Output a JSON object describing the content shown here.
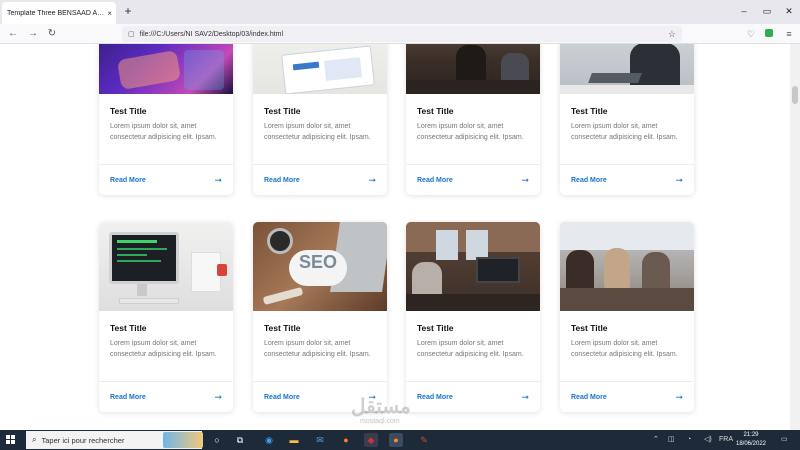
{
  "browser": {
    "tab_title": "Template Three BENSAAD Abdelha",
    "tab_close": "×",
    "new_tab": "+",
    "url": "file:///C:/Users/NI SAV2/Desktop/03/index.html",
    "window_controls": [
      "–",
      "▭",
      "✕"
    ]
  },
  "cards": [
    {
      "title": "Test Title",
      "desc": "Lorem ipsum dolor sit, amet consectetur adipisicing elit. Ipsam.",
      "link": "Read More",
      "arrow": "➞"
    },
    {
      "title": "Test Title",
      "desc": "Lorem ipsum dolor sit, amet consectetur adipisicing elit. Ipsam.",
      "link": "Read More",
      "arrow": "➞"
    },
    {
      "title": "Test Title",
      "desc": "Lorem ipsum dolor sit, amet consectetur adipisicing elit. Ipsam.",
      "link": "Read More",
      "arrow": "➞"
    },
    {
      "title": "Test Title",
      "desc": "Lorem ipsum dolor sit, amet consectetur adipisicing elit. Ipsam.",
      "link": "Read More",
      "arrow": "➞"
    },
    {
      "title": "Test Title",
      "desc": "Lorem ipsum dolor sit, amet consectetur adipisicing elit. Ipsam.",
      "link": "Read More",
      "arrow": "➞"
    },
    {
      "title": "Test Title",
      "desc": "Lorem ipsum dolor sit, amet consectetur adipisicing elit. Ipsam.",
      "link": "Read More",
      "arrow": "➞"
    },
    {
      "title": "Test Title",
      "desc": "Lorem ipsum dolor sit, amet consectetur adipisicing elit. Ipsam.",
      "link": "Read More",
      "arrow": "➞"
    },
    {
      "title": "Test Title",
      "desc": "Lorem ipsum dolor sit, amet consectetur adipisicing elit. Ipsam.",
      "link": "Read More",
      "arrow": "➞"
    }
  ],
  "taskbar": {
    "search_placeholder": "Taper ici pour rechercher",
    "language": "FRA",
    "time": "21:29",
    "date": "18/06/2022"
  },
  "watermark": {
    "text": "مستقل",
    "sub": "mostaql.com"
  },
  "colors": {
    "accent": "#1a73c9",
    "taskbar": "#1d2a3a"
  }
}
